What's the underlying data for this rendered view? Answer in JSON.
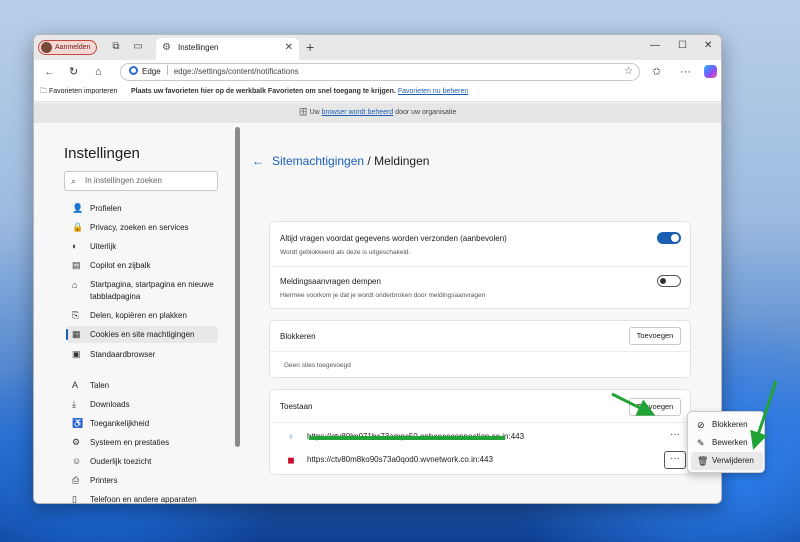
{
  "browser": {
    "profile_label": "Aanmelden",
    "tab_title": "Instellingen",
    "omnibox_brand": "Edge",
    "url": "edge://settings/content/notifications"
  },
  "favorites_bar": {
    "import_label": "Favorieten importeren",
    "hint_text": "Plaats uw favorieten hier op de werkbalk Favorieten om snel toegang te krijgen.",
    "manage_link": "Favorieten nu beheren"
  },
  "managed_banner": {
    "prefix": "Uw",
    "link": "browser wordt beheerd",
    "suffix": "door uw organisatie"
  },
  "sidebar": {
    "title": "Instellingen",
    "search_placeholder": "In instellingen zoeken",
    "items": [
      {
        "label": "Profielen",
        "icon": "profile-icon"
      },
      {
        "label": "Privacy, zoeken en services",
        "icon": "lock-icon"
      },
      {
        "label": "Uiterlijk",
        "icon": "appearance-icon"
      },
      {
        "label": "Copilot en zijbalk",
        "icon": "sidebar-icon"
      },
      {
        "label": "Startpagina, startpagina en nieuwe tabbladpagina",
        "icon": "home-icon"
      },
      {
        "label": "Delen, kopiëren en plakken",
        "icon": "share-icon"
      },
      {
        "label": "Cookies en site machtigingen",
        "icon": "cookie-icon",
        "active": true
      },
      {
        "label": "Standaardbrowser",
        "icon": "browser-icon"
      },
      {
        "label": "Talen",
        "icon": "language-icon"
      },
      {
        "label": "Downloads",
        "icon": "download-icon"
      },
      {
        "label": "Toegankelijkheid",
        "icon": "accessibility-icon"
      },
      {
        "label": "Systeem en prestaties",
        "icon": "system-icon"
      },
      {
        "label": "Ouderlijk toezicht",
        "icon": "family-icon"
      },
      {
        "label": "Printers",
        "icon": "printer-icon"
      },
      {
        "label": "Telefoon en andere apparaten",
        "icon": "phone-icon"
      }
    ]
  },
  "main": {
    "breadcrumb_parent": "Sitemachtigingen",
    "breadcrumb_separator": " / ",
    "page_title": "Meldingen",
    "settings": [
      {
        "title": "Altijd vragen voordat gegevens worden verzonden (aanbevolen)",
        "subtitle": "Wordt geblokkeerd als deze is uitgeschakeld.",
        "toggle": "on"
      },
      {
        "title": "Meldingsaanvragen dempen",
        "subtitle": "Hiermee voorkom je dat je wordt onderbroken door meldingsaanvragen",
        "toggle": "off"
      }
    ],
    "block": {
      "title": "Blokkeren",
      "add_label": "Toevoegen",
      "empty_text": "Geen sites toegevoegd"
    },
    "allow": {
      "title": "Toestaan",
      "add_label": "Toevoegen",
      "sites": [
        "https://ctv80lm071bc73ampc50.enhanceconnection.co.in:443",
        "https://ctv80m8ko90s73a0qod0.wvnetwork.co.in:443"
      ]
    }
  },
  "context_menu": {
    "items": [
      {
        "label": "Blokkeren",
        "icon": "block-icon"
      },
      {
        "label": "Bewerken",
        "icon": "edit-icon"
      },
      {
        "label": "Verwijderen",
        "icon": "trash-icon"
      }
    ]
  },
  "colors": {
    "accent": "#1a5fb4",
    "annotation_green": "#21a336"
  }
}
